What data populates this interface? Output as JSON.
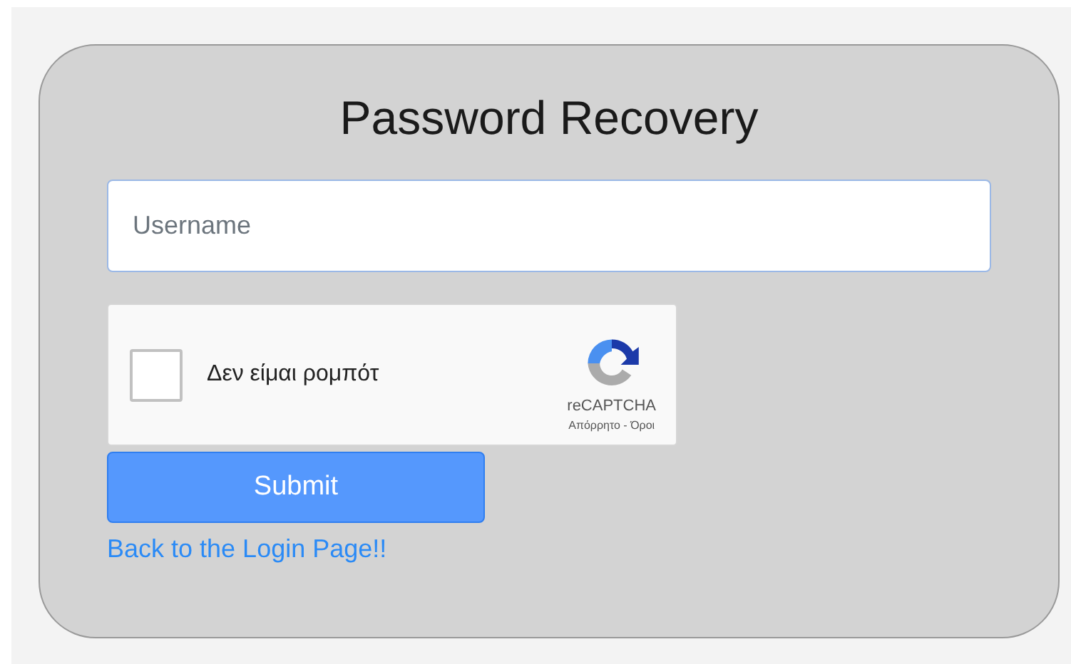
{
  "title": "Password Recovery",
  "username": {
    "placeholder": "Username"
  },
  "captcha": {
    "checked": false,
    "label": "Δεν είμαι ρομπότ",
    "brand": "reCAPTCHA",
    "links": "Απόρρητο - Όροι"
  },
  "submit": "Submit",
  "back_link": "Back to the Login Page!!"
}
